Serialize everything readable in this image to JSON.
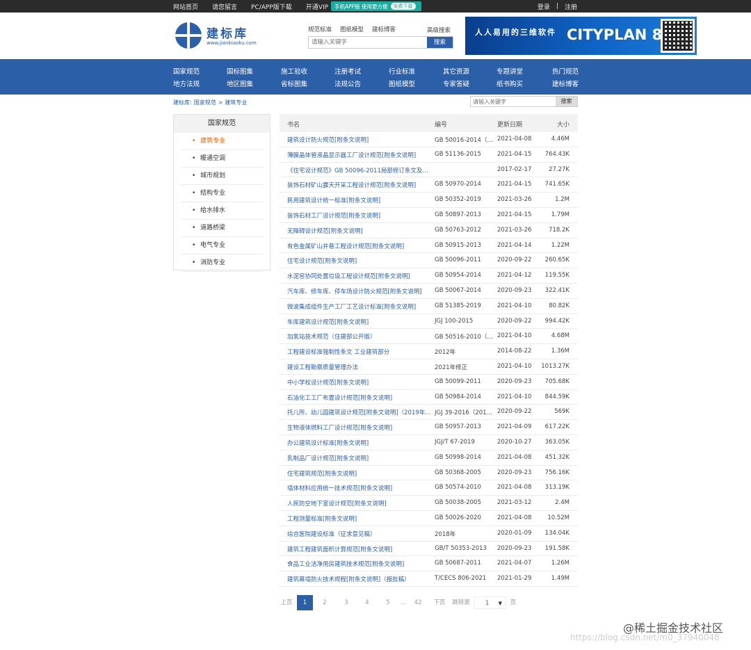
{
  "topbar": {
    "links": [
      "网站首页",
      "请您留言",
      "PC/APP版下载",
      "开通VIP"
    ],
    "app_badge": "手机APP版 使用更方便",
    "app_free": "免费下载",
    "login": "登录",
    "sep": "|",
    "register": "注册"
  },
  "logo": {
    "title": "建标库",
    "url": "www.jianbiaoku.com"
  },
  "search": {
    "tabs": [
      "规范标准",
      "图纸模型",
      "建标博客"
    ],
    "advanced": "高级搜索",
    "placeholder": "请输入关键字",
    "button": "搜索"
  },
  "banner": {
    "tagline": "人人易用的三维软件",
    "title": "CITYPLAN 8.0"
  },
  "nav": {
    "row1": [
      "国家规范",
      "国标图集",
      "施工验收",
      "注册考试",
      "行业标准",
      "其它资源",
      "专题讲堂",
      "热门规范"
    ],
    "row2": [
      "地方法规",
      "地区图集",
      "省标图集",
      "法规公告",
      "图纸模型",
      "专家答疑",
      "纸书购买",
      "建标博客"
    ]
  },
  "breadcrumb": {
    "home": "建标库:",
    "level1": "国家规范",
    "arrow": ">",
    "level2": "建筑专业"
  },
  "search2": {
    "placeholder": "请输入关键字",
    "button": "搜索"
  },
  "sidebar": {
    "title": "国家规范",
    "items": [
      "建筑专业",
      "暖通空调",
      "城市规划",
      "结构专业",
      "给水排水",
      "道路桥梁",
      "电气专业",
      "消防专业"
    ]
  },
  "table": {
    "headers": {
      "name": "书名",
      "code": "编号",
      "date": "更新日期",
      "size": "大小"
    },
    "rows": [
      [
        "建筑设计防火规范[附条文说明]",
        "GB 50016-2014（2...",
        "2021-04-08",
        "4.46M"
      ],
      [
        "薄膜晶体管液晶显示器工厂设计规范[附条文说明]",
        "GB 51136-2015",
        "2021-04-15",
        "764.43K"
      ],
      [
        "《住宅设计规范》GB 50096-2011局部修订条文及说...",
        "",
        "2017-02-17",
        "27.27K"
      ],
      [
        "装饰石材矿山露天开采工程设计规范[附条文说明]",
        "GB 50970-2014",
        "2021-04-15",
        "741.65K"
      ],
      [
        "民用建筑设计统一标准[附条文说明]",
        "GB 50352-2019",
        "2021-03-26",
        "1.2M"
      ],
      [
        "装饰石材工厂设计规范[附条文说明]",
        "GB 50897-2013",
        "2021-04-15",
        "1.79M"
      ],
      [
        "无障碍设计规范[附条文说明]",
        "GB 50763-2012",
        "2021-03-26",
        "718.2K"
      ],
      [
        "有色金属矿山井巷工程设计规范[附条文说明]",
        "GB 50915-2013",
        "2021-04-14",
        "1.22M"
      ],
      [
        "住宅设计规范[附条文说明]",
        "GB 50096-2011",
        "2020-09-22",
        "260.65K"
      ],
      [
        "水泥窑协同处置垃圾工程设计规范[附条文说明]",
        "GB 50954-2014",
        "2021-04-12",
        "119.55K"
      ],
      [
        "汽车库、修车库、停车场设计防火规范[附条文说明]",
        "GB 50067-2014",
        "2020-09-23",
        "322.41K"
      ],
      [
        "微波集成组件生产工厂工艺设计标准[附条文说明]",
        "GB 51385-2019",
        "2021-04-10",
        "80.82K"
      ],
      [
        "车库建筑设计规范[附条文说明]",
        "JGJ 100-2015",
        "2020-09-22",
        "994.42K"
      ],
      [
        "加氢站技术规范（住建部公开版）",
        "GB 50516-2010（2...",
        "2021-04-10",
        "4.68M"
      ],
      [
        "工程建设标准强制性条文 工业建筑部分",
        "2012年",
        "2014-08-22",
        "1.36M"
      ],
      [
        "建设工程勘察质量管理办法",
        "2021年修正",
        "2021-04-10",
        "1013.27K"
      ],
      [
        "中小学校设计规范[附条文说明]",
        "GB 50099-2011",
        "2020-09-23",
        "705.68K"
      ],
      [
        "石油化工工厂布置设计规范[附条文说明]",
        "GB 50984-2014",
        "2021-04-10",
        "844.59K"
      ],
      [
        "托儿所、幼儿园建筑设计规范[附条文说明]（2019年...",
        "JGJ 39-2016（2019...",
        "2020-09-22",
        "569K"
      ],
      [
        "生物液体燃料工厂设计规范[附条文说明]",
        "GB 50957-2013",
        "2021-04-09",
        "617.22K"
      ],
      [
        "办公建筑设计标准[附条文说明]",
        "JGJ/T 67-2019",
        "2020-10-27",
        "363.05K"
      ],
      [
        "乳制品厂设计规范[附条文说明]",
        "GB 50998-2014",
        "2021-04-08",
        "451.32K"
      ],
      [
        "住宅建筑规范[附条文说明]",
        "GB 50368-2005",
        "2020-09-23",
        "756.16K"
      ],
      [
        "墙体材料应用统一技术规范[附条文说明]",
        "GB 50574-2010",
        "2021-04-08",
        "313.19K"
      ],
      [
        "人民防空地下室设计规范[附条文说明]",
        "GB 50038-2005",
        "2021-03-12",
        "2.4M"
      ],
      [
        "工程测量标准[附条文说明]",
        "GB 50026-2020",
        "2021-04-08",
        "10.52M"
      ],
      [
        "综合医院建设标准（征求意见稿）",
        "2018年",
        "2020-01-09",
        "134.04K"
      ],
      [
        "建筑工程建筑面积计算规范[附条文说明]",
        "GB/T 50353-2013",
        "2020-09-23",
        "191.58K"
      ],
      [
        "食品工业洁净用房建筑技术规范[附条文说明]",
        "GB 50687-2011",
        "2021-04-07",
        "1.26M"
      ],
      [
        "建筑幕墙防火技术规程[附条文说明]（报批稿）",
        "T/CECS 806-2021",
        "2021-01-29",
        "1.49M"
      ]
    ]
  },
  "pager": {
    "prev": "上页",
    "pages": [
      "1",
      "2",
      "3",
      "4",
      "5"
    ],
    "ellipsis": "...",
    "last": "42",
    "next": "下页",
    "jump": "跳转第",
    "jump_value": "1",
    "page_unit": "页"
  },
  "watermark": {
    "brand": "@稀土掘金技术社区",
    "url": "https://blog.csdn.net/m0_37940048"
  }
}
